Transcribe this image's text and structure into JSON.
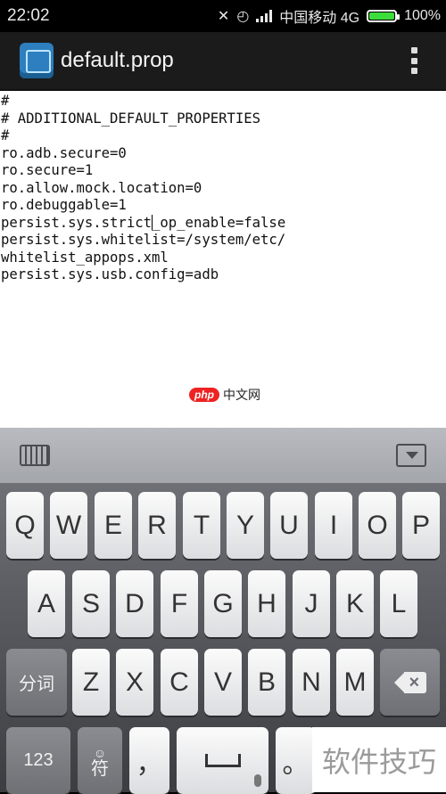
{
  "status_bar": {
    "time": "22:02",
    "carrier": "中国移动 4G",
    "battery": "100%"
  },
  "app_bar": {
    "title": "default.prop"
  },
  "editor": {
    "lines_before_cursor": "#\n# ADDITIONAL_DEFAULT_PROPERTIES\n#\nro.adb.secure=0\nro.secure=1\nro.allow.mock.location=0\nro.debuggable=1\npersist.sys.strict",
    "lines_after_cursor": "_op_enable=false\npersist.sys.whitelist=/system/etc/\nwhitelist_appops.xml\npersist.sys.usb.config=adb"
  },
  "watermark": {
    "logo": "php",
    "text": "中文网"
  },
  "keyboard": {
    "row1": [
      "Q",
      "W",
      "E",
      "R",
      "T",
      "Y",
      "U",
      "I",
      "O",
      "P"
    ],
    "row2": [
      "A",
      "S",
      "D",
      "F",
      "G",
      "H",
      "J",
      "K",
      "L"
    ],
    "row3": [
      "Z",
      "X",
      "C",
      "V",
      "B",
      "N",
      "M"
    ],
    "row3_left": "分词",
    "num_key": "123",
    "symbol_key_top": "☺",
    "symbol_key_bottom": "符",
    "comma_key": "，",
    "period_key": "。"
  },
  "corner_watermark": "软件技巧"
}
